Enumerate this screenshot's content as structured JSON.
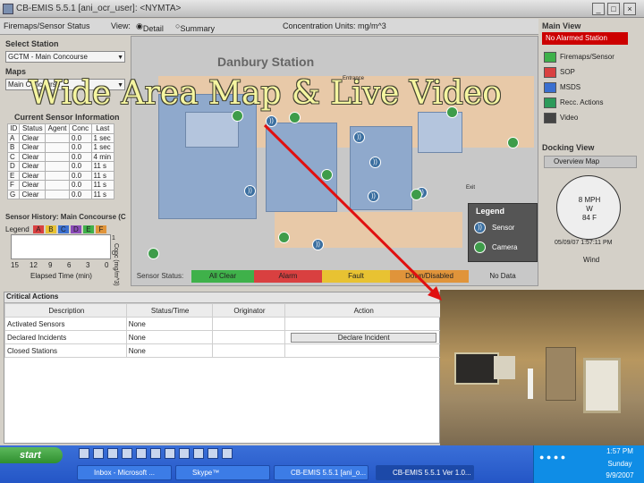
{
  "window": {
    "title": "CB-EMIS 5.5.1 [ani_ocr_user]: <NYMTA>"
  },
  "menubar": {
    "firemaps_label": "Firemaps/Sensor Status",
    "view_label": "View:",
    "detail_label": "Detail",
    "summary_label": "Summary",
    "concentration_label": "Concentration Units: mg/m^3"
  },
  "left": {
    "select_station_title": "Select Station",
    "station_value": "GCTM - Main Concourse",
    "maps_title": "Maps",
    "map_value": "Main Concourse",
    "current_sensor_title": "Current Sensor Information",
    "sensor_columns": [
      "ID",
      "Status",
      "Agent",
      "Conc",
      "Last"
    ],
    "sensor_rows": [
      [
        "A",
        "Clear",
        "",
        "0.0",
        "1 sec"
      ],
      [
        "B",
        "Clear",
        "",
        "0.0",
        "1 sec"
      ],
      [
        "C",
        "Clear",
        "",
        "0.0",
        "4 min"
      ],
      [
        "D",
        "Clear",
        "",
        "0.0",
        "11 s"
      ],
      [
        "E",
        "Clear",
        "",
        "0.0",
        "11 s"
      ],
      [
        "F",
        "Clear",
        "",
        "0.0",
        "11 s"
      ],
      [
        "G",
        "Clear",
        "",
        "0.0",
        "11 s"
      ]
    ],
    "history_title": "Sensor History: Main Concourse (C",
    "legend_label": "Legend",
    "legend_letters": [
      "A",
      "B",
      "C",
      "D",
      "E",
      "F"
    ],
    "xticks": [
      "15",
      "12",
      "9",
      "6",
      "3",
      "0"
    ],
    "xlabel": "Elapsed Time (min)",
    "ylabel": "Conc (mg/m^3)",
    "yticks": [
      "1",
      "0"
    ]
  },
  "map": {
    "station_name": "Danbury Station",
    "entrance_label": "Entrance",
    "exit_label": "Exit",
    "legend_title": "Legend",
    "legend_sensor": "Sensor",
    "legend_camera": "Camera",
    "status_label": "Sensor Status:",
    "status_items": [
      {
        "label": "All Clear",
        "color": "#3fb14a"
      },
      {
        "label": "Alarm",
        "color": "#d94040"
      },
      {
        "label": "Fault",
        "color": "#e8c232"
      },
      {
        "label": "Down/Disabled",
        "color": "#e0943a"
      },
      {
        "label": "No Data",
        "color": "#c8c8c8"
      }
    ]
  },
  "right": {
    "main_view_title": "Main View",
    "alarm_label": "No Alarmed Station",
    "items": [
      {
        "label": "Firemaps/Sensor",
        "color": "#3fb14a"
      },
      {
        "label": "SOP",
        "color": "#d94040"
      },
      {
        "label": "MSDS",
        "color": "#3a6fd0"
      },
      {
        "label": "Recc. Actions",
        "color": "#2c9a5a"
      },
      {
        "label": "Video",
        "color": "#444444"
      }
    ],
    "docking_title": "Docking View",
    "docking_sub": "Overview Map",
    "wind_label": "Wind",
    "wind_speed": "8 MPH",
    "wind_dir": "W",
    "wind_temp": "84 F",
    "wind_time": "05/09/07 1:57:11 PM"
  },
  "critical": {
    "title": "Critical Actions",
    "columns": [
      "Description",
      "Status/Time",
      "Originator",
      "Action"
    ],
    "rows": [
      {
        "desc": "Activated Sensors",
        "status": "None",
        "origin": "",
        "action": ""
      },
      {
        "desc": "Declared Incidents",
        "status": "None",
        "origin": "",
        "action": "Declare Incident"
      },
      {
        "desc": "Closed Stations",
        "status": "None",
        "origin": "",
        "action": ""
      }
    ]
  },
  "overlay": {
    "headline": "Wide Area Map & Live Video"
  },
  "taskbar": {
    "start_label": "start",
    "tasks": [
      "Inbox - Microsoft ...",
      "Skype™",
      "CB-EMIS 5.5.1 [ani_o...",
      "CB-EMIS 5.5.1 Ver 1.0..."
    ],
    "clock_time": "1:57 PM",
    "clock_day": "Sunday",
    "clock_date": "9/9/2007"
  },
  "colors": {
    "alarm_red": "#cc0000",
    "arrow_red": "#e01010",
    "taskbar_blue": "#2456c6"
  }
}
